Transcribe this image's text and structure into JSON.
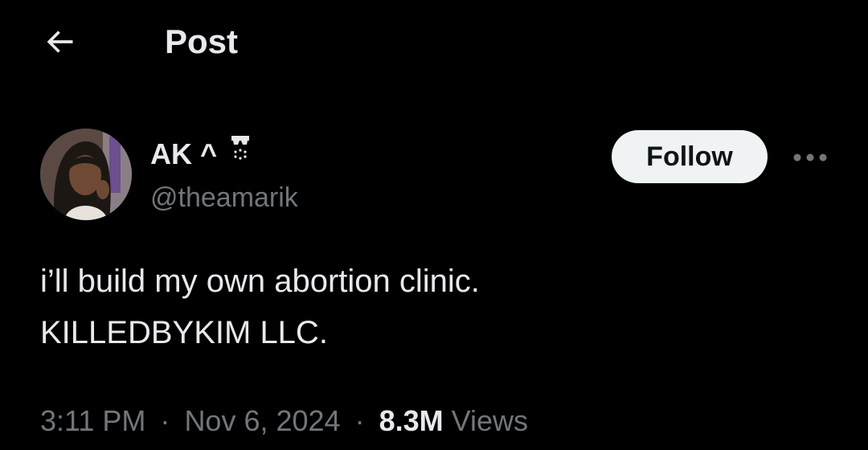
{
  "header": {
    "back_icon": "arrow-left-icon",
    "title": "Post"
  },
  "author": {
    "display_name": "AK ^",
    "name_glyph": "decorative-emoji-icon",
    "handle": "@theamarik",
    "follow_label": "Follow",
    "more_icon": "more-horizontal-icon"
  },
  "post": {
    "lines": [
      "i’ll build my own abortion clinic.",
      "KILLEDBYKIM LLC."
    ]
  },
  "meta": {
    "time": "3:11 PM",
    "separator": "·",
    "date": "Nov 6, 2024",
    "views_count": "8.3M",
    "views_label": "Views"
  },
  "colors": {
    "background": "#000000",
    "primary_text": "#e7e9ea",
    "secondary_text": "#71767b",
    "follow_bg": "#eff3f4",
    "follow_text": "#0f1419"
  }
}
